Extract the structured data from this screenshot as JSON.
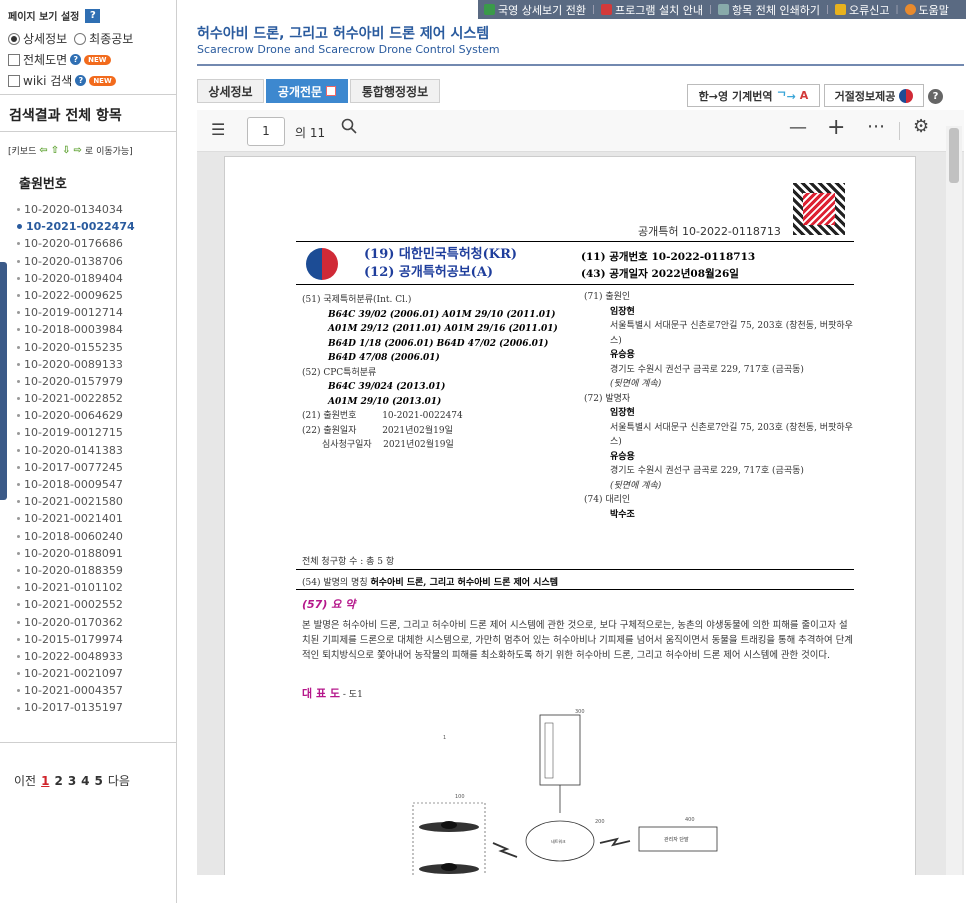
{
  "sidebar": {
    "settings_title": "페이지 보기 설정",
    "settings_help": "?",
    "radio_detail": "상세정보",
    "radio_final": "최종공보",
    "chk_fulldraw": "전체도면",
    "chk_wiki": "wiki 검색",
    "new_badge": "NEW",
    "result_title": "검색결과 전체 항목",
    "keyhelp_prefix": "[키보드",
    "keyhelp_suffix": "로 이동가능]",
    "app_heading": "출원번호",
    "items": [
      "10-2020-0134034",
      "10-2021-0022474",
      "10-2020-0176686",
      "10-2020-0138706",
      "10-2020-0189404",
      "10-2022-0009625",
      "10-2019-0012714",
      "10-2018-0003984",
      "10-2020-0155235",
      "10-2020-0089133",
      "10-2020-0157979",
      "10-2021-0022852",
      "10-2020-0064629",
      "10-2019-0012715",
      "10-2020-0141383",
      "10-2017-0077245",
      "10-2018-0009547",
      "10-2021-0021580",
      "10-2021-0021401",
      "10-2018-0060240",
      "10-2020-0188091",
      "10-2020-0188359",
      "10-2021-0101102",
      "10-2021-0002552",
      "10-2020-0170362",
      "10-2015-0179974",
      "10-2022-0048933",
      "10-2021-0021097",
      "10-2021-0004357",
      "10-2017-0135197"
    ],
    "active_index": 1,
    "pager": {
      "prev": "이전",
      "pages": [
        "1",
        "2",
        "3",
        "4",
        "5"
      ],
      "next": "다음"
    }
  },
  "topbar": [
    "국영 상세보기 전환",
    "프로그램 설치 안내",
    "항목 전체 인쇄하기",
    "오류신고",
    "도움말"
  ],
  "header": {
    "title_ko": "허수아비 드론, 그리고 허수아비 드론 제어 시스템",
    "title_en": "Scarecrow Drone and Scarecrow Drone Control System"
  },
  "tabs": [
    "상세정보",
    "공개전문",
    "통합행정정보"
  ],
  "active_tab": 1,
  "translate_btn": "한→영 기계번역",
  "refuse_btn": "거절정보제공",
  "help": "?",
  "viewer": {
    "page": "1",
    "total": "의 11"
  },
  "doc": {
    "pub_head": "공개특허 10-2022-0118713",
    "office_1": "(19) 대한민국특허청(KR)",
    "office_2": "(12) 공개특허공보(A)",
    "meta_1": "(11) 공개번호    10-2022-0118713",
    "meta_2": "(43) 공개일자    2022년08월26일",
    "ipc_label": "(51) 국제특허분류(Int. Cl.)",
    "ipc_lines": [
      "B64C 39/02 (2006.01)  A01M 29/10 (2011.01)",
      "A01M 29/12 (2011.01)  A01M 29/16 (2011.01)",
      "B64D 1/18 (2006.01)  B64D 47/02 (2006.01)",
      "B64D 47/08 (2006.01)"
    ],
    "cpc_label": "(52) CPC특허분류",
    "cpc_lines": [
      "B64C 39/024 (2013.01)",
      "A01M 29/10 (2013.01)"
    ],
    "appno": "(21) 출원번호         10-2021-0022474",
    "appdate": "(22) 출원일자         2021년02월19일",
    "examdate": "       심사청구일자    2021년02월19일",
    "applicant_label": "(71) 출원인",
    "applicant_1": "임장현",
    "applicant_1_addr": "서울특별시 서대문구 신촌로7안길 75, 203호 (창천동, 버팟하우스)",
    "applicant_2": "유승용",
    "applicant_2_addr": "경기도 수원시 권선구 금곡로 229, 717호 (금곡동)",
    "continued": "(뒷면에 계속)",
    "inventor_label": "(72) 발명자",
    "inventor_1": "임장현",
    "inventor_1_addr": "서울특별시 서대문구 신촌로7안길 75, 203호 (창천동, 버팟하우스)",
    "inventor_2": "유승용",
    "inventor_2_addr": "경기도 수원시 권선구 금곡로 229, 717호 (금곡동)",
    "agent_label": "(74) 대리인",
    "agent": "박수조",
    "claims": "전체 청구항 수 : 총 5 항",
    "inv_label": "(54) 발명의 명칭",
    "inv_title": "허수아비 드론, 그리고 허수아비 드론 제어 시스템",
    "abstract_label": "(57) 요 약",
    "abstract": "본 발명은 허수아비 드론, 그리고 허수아비 드론 제어 시스템에 관한 것으로, 보다 구체적으로는, 농촌의 야생동물에 의한 피해를 줄이고자 설치된 기피제를 드론으로 대체한 시스템으로, 가만히 멈추어 있는 허수아비나 기피제를 넘어서 움직이면서 동물을 트래킹을 통해 추격하여 단계적인 퇴치방식으로 쫓아내어 농작물의 피해를 최소화하도록 하기 위한 허수아비 드론, 그리고 허수아비 드론 제어 시스템에 관한 것이다.",
    "rep_label": "대 표 도",
    "rep_value": "- 도1",
    "fig_labels": [
      "1",
      "300",
      "100",
      "200",
      "400",
      "네트워크",
      "관리자 단말"
    ]
  }
}
